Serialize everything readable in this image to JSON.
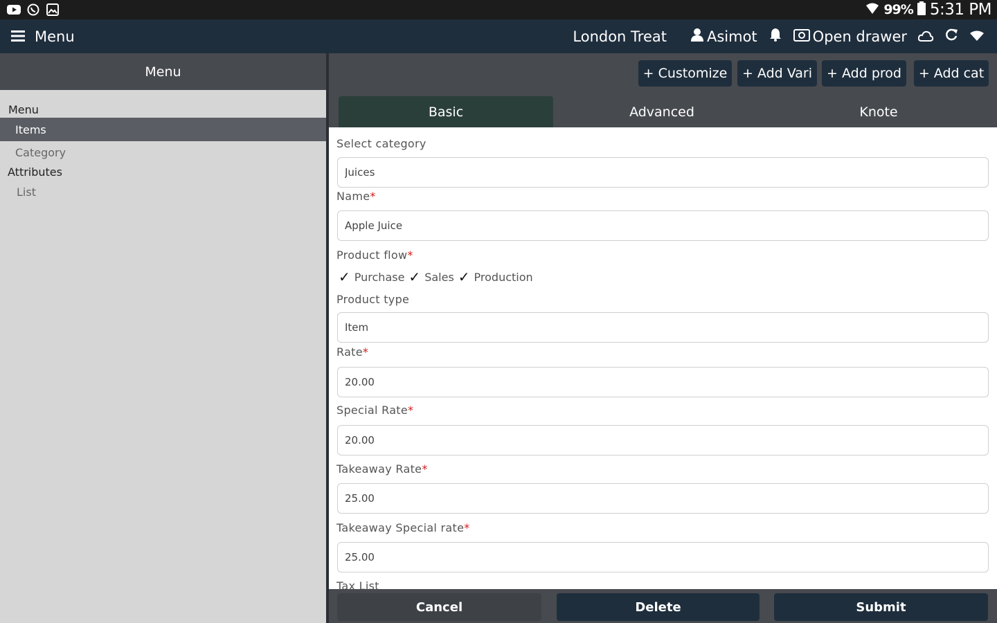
{
  "status_bar": {
    "left_icons": [
      "youtube-icon",
      "whatsapp-icon",
      "gallery-icon"
    ],
    "battery_pct": "99%",
    "time": "5:31 PM"
  },
  "app_bar": {
    "menu_label": "Menu",
    "store_name": "London Treat",
    "user_name": "Asimot",
    "open_drawer_label": "Open drawer"
  },
  "sidebar": {
    "header": "Menu",
    "section_menu": "Menu",
    "item_items": "Items",
    "item_category": "Category",
    "section_attributes": "Attributes",
    "item_list": "List"
  },
  "toolbar": {
    "customize": "+ Customize",
    "add_vari": "+ Add Vari",
    "add_prod": "+ Add prod",
    "add_cat": "+ Add cat"
  },
  "tabs": {
    "basic": "Basic",
    "advanced": "Advanced",
    "knote": "Knote"
  },
  "form": {
    "category_label": "Select category",
    "category_value": "Juices",
    "name_label": "Name",
    "name_value": "Apple Juice",
    "flow_label": "Product flow",
    "flow_purchase": "Purchase",
    "flow_sales": "Sales",
    "flow_production": "Production",
    "type_label": "Product type",
    "type_value": "Item",
    "rate_label": "Rate",
    "rate_value": "20.00",
    "special_rate_label": "Special Rate",
    "special_rate_value": "20.00",
    "takeaway_rate_label": "Takeaway Rate",
    "takeaway_rate_value": "25.00",
    "takeaway_special_label": "Takeaway Special rate",
    "takeaway_special_value": "25.00",
    "tax_list_label": "Tax List",
    "required_mark": "*"
  },
  "footer": {
    "cancel": "Cancel",
    "delete": "Delete",
    "submit": "Submit"
  },
  "colors": {
    "app_bar": "#1f2e3d",
    "toolbar": "#474a4f",
    "sidebar": "#d6d6d6",
    "active_tab": "#2b3f3a",
    "required": "#d61a1a"
  }
}
